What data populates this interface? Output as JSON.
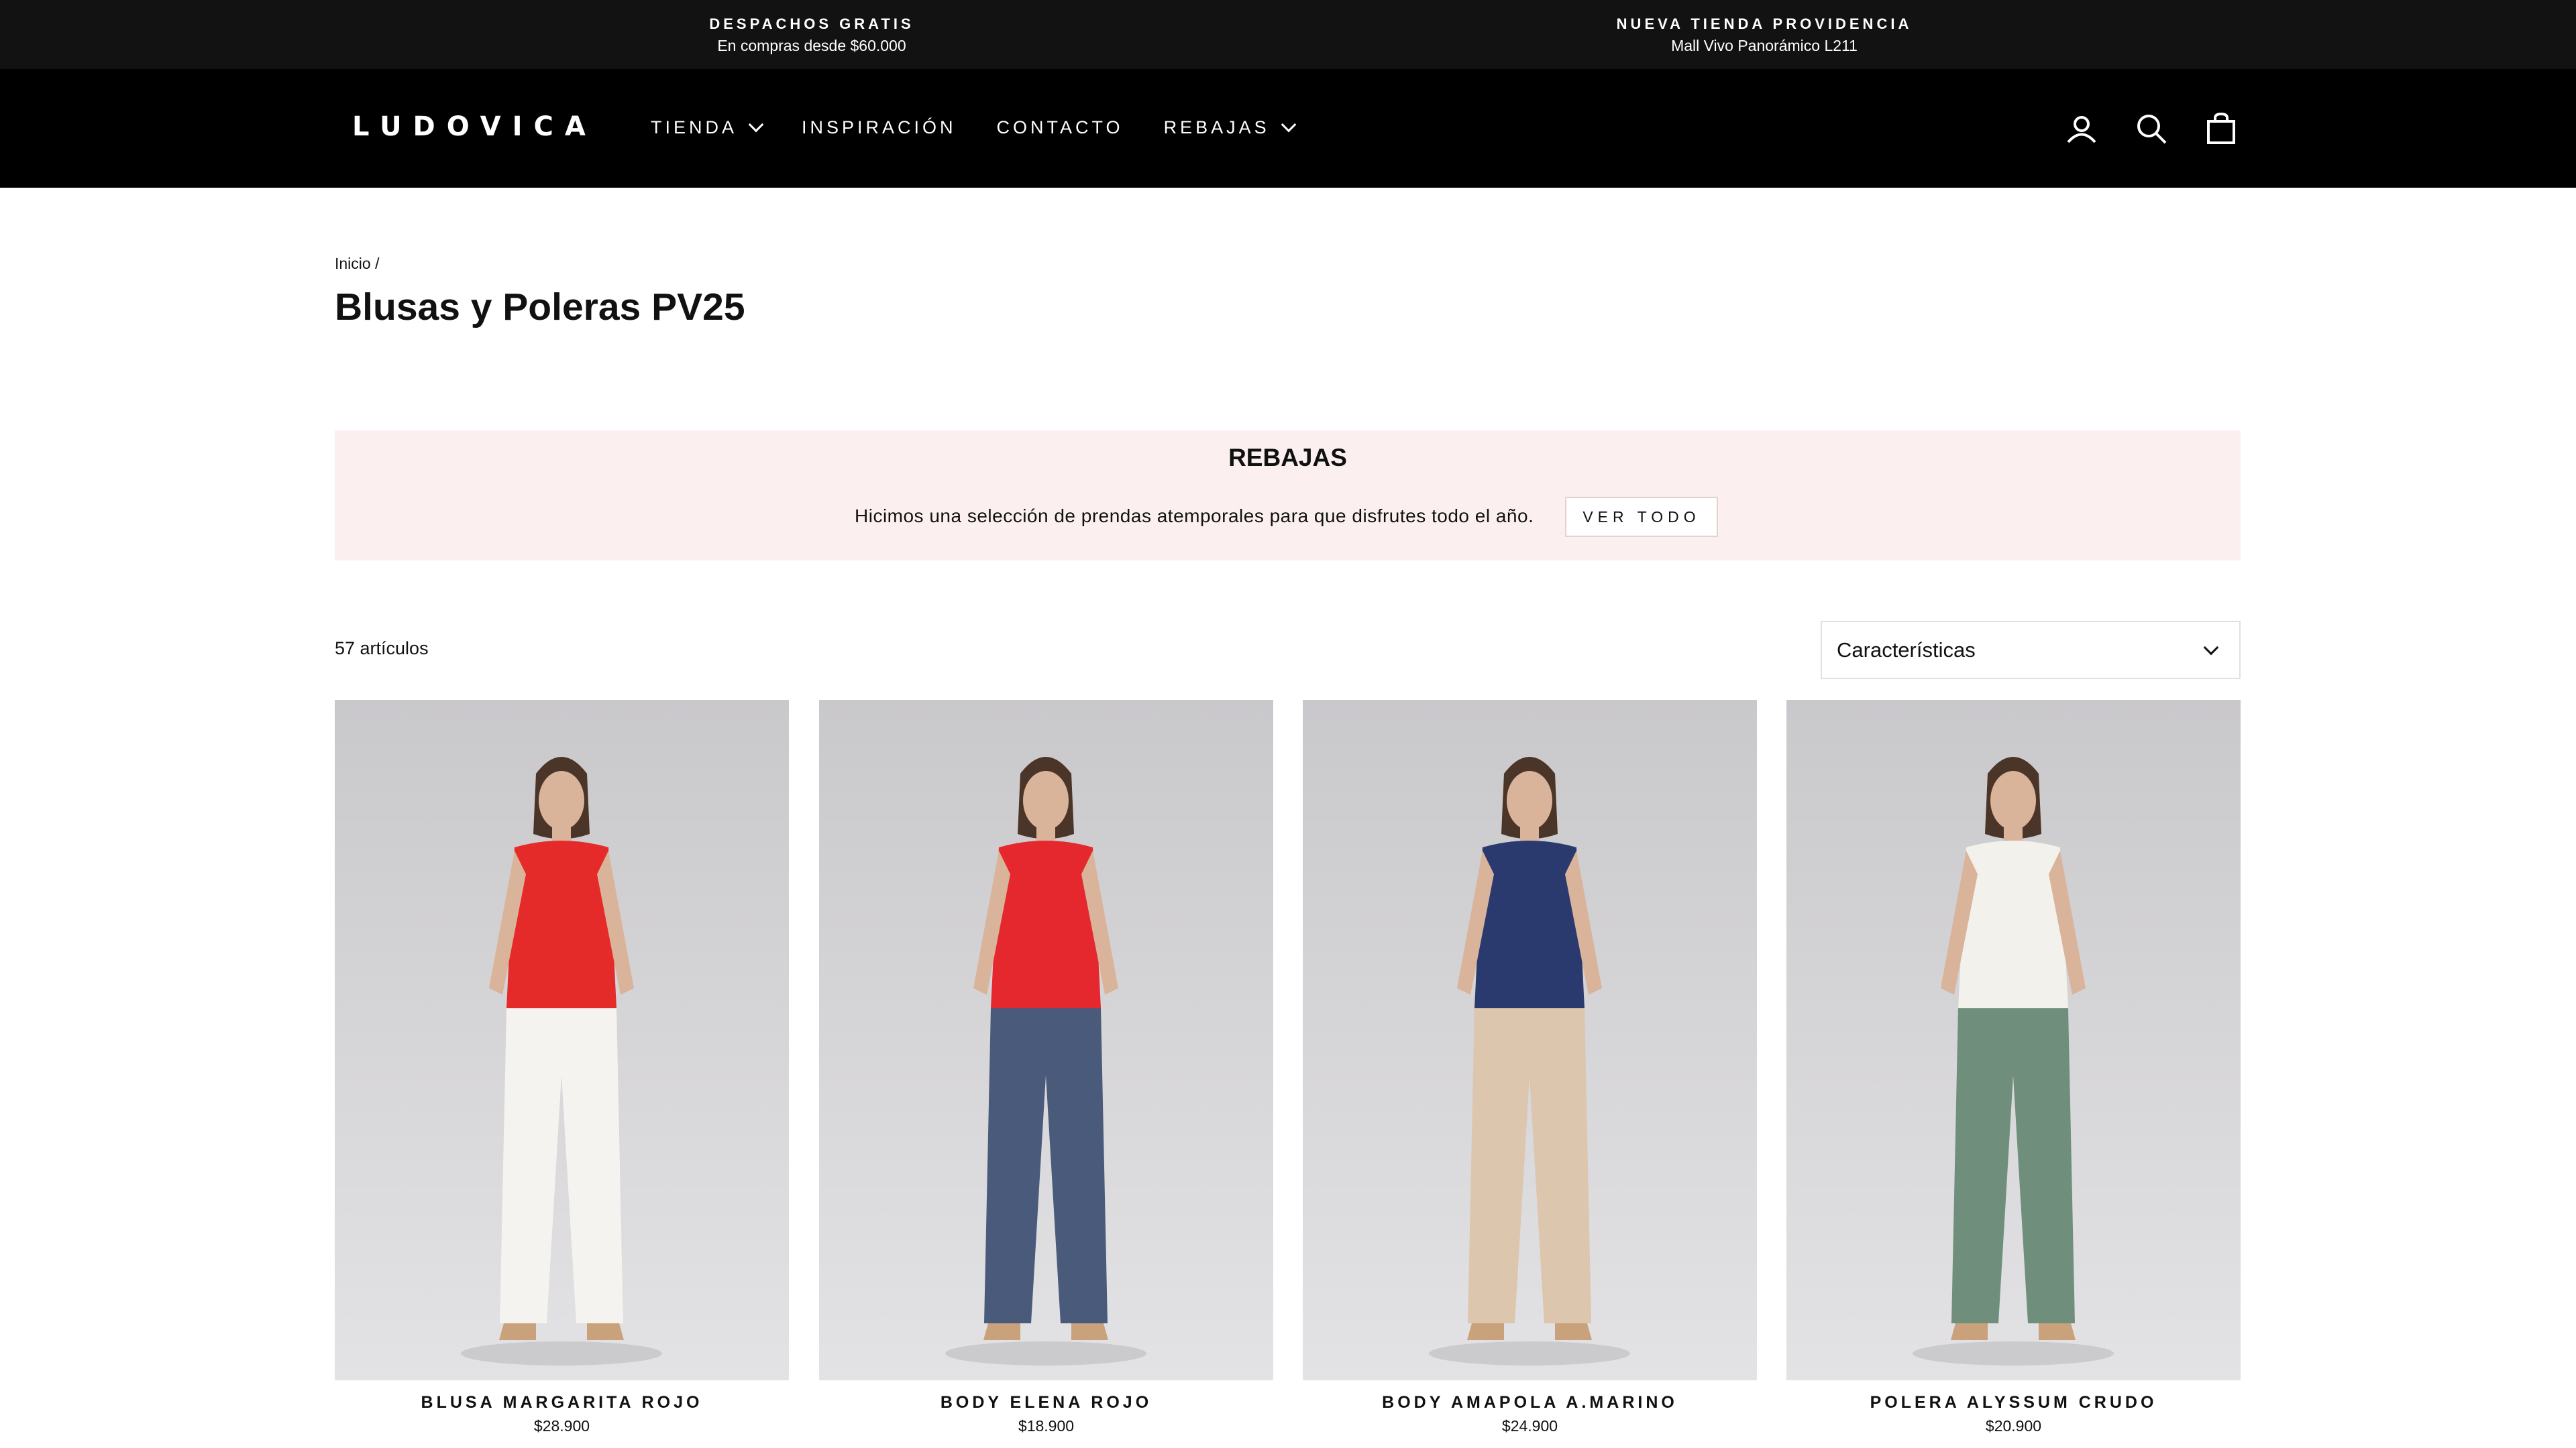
{
  "announcement": [
    {
      "title": "DESPACHOS GRATIS",
      "subtitle": "En compras desde $60.000"
    },
    {
      "title": "NUEVA TIENDA PROVIDENCIA",
      "subtitle": "Mall Vivo Panorámico L211"
    }
  ],
  "header": {
    "logo": "LUDOVICA",
    "nav": [
      "TIENDA",
      "INSPIRACIÓN",
      "CONTACTO",
      "REBAJAS"
    ],
    "icons": [
      "account-icon",
      "search-icon",
      "cart-icon"
    ]
  },
  "breadcrumb": "Inicio /",
  "page_title": "Blusas y Poleras PV25",
  "promo": {
    "title": "REBAJAS",
    "text": "Hicimos una selección de prendas atemporales para que disfrutes todo el año.",
    "button": "VER TODO",
    "bg_color": "#fbf0ef"
  },
  "toolbar": {
    "count": "57 artículos",
    "sort_value": "Características"
  },
  "products": [
    {
      "name": "BLUSA MARGARITA ROJO",
      "price": "$28.900",
      "top_color": "#e52a2a",
      "bottom_color": "#f4f3ef"
    },
    {
      "name": "BODY ELENA ROJO",
      "price": "$18.900",
      "top_color": "#e5282e",
      "bottom_color": "#4a5a7a"
    },
    {
      "name": "BODY AMAPOLA A.MARINO",
      "price": "$24.900",
      "top_color": "#2b3a6e",
      "bottom_color": "#dcc6ae"
    },
    {
      "name": "POLERA ALYSSUM CRUDO",
      "price": "$20.900",
      "top_color": "#f3f1ec",
      "bottom_color": "#6f8f7c"
    }
  ]
}
